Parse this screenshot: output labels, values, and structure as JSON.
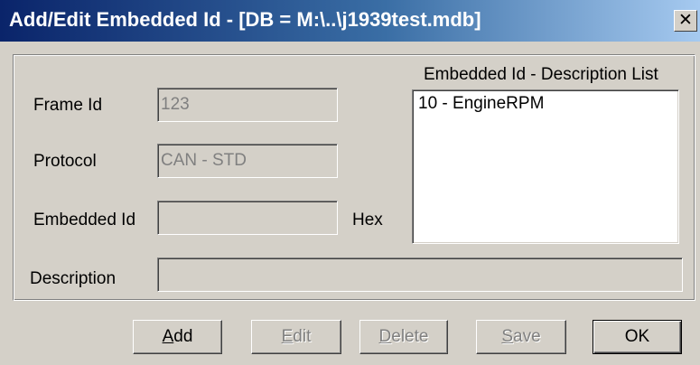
{
  "window": {
    "title": "Add/Edit Embedded Id - [DB = M:\\..\\j1939test.mdb]",
    "close_glyph": "✕"
  },
  "form": {
    "frame_id_label": "Frame Id",
    "frame_id_value": "123",
    "protocol_label": "Protocol",
    "protocol_value": "CAN - STD",
    "embedded_id_label": "Embedded Id",
    "embedded_id_value": "",
    "hex_label": "Hex",
    "description_label": "Description",
    "description_value": ""
  },
  "list": {
    "header": "Embedded Id - Description List",
    "items": [
      "10 - EngineRPM"
    ]
  },
  "buttons": {
    "add": {
      "mnemonic": "A",
      "rest": "dd",
      "enabled": true
    },
    "edit": {
      "mnemonic": "E",
      "rest": "dit",
      "enabled": false
    },
    "delete": {
      "mnemonic": "D",
      "rest": "elete",
      "enabled": false
    },
    "save": {
      "mnemonic": "S",
      "rest": "ave",
      "enabled": false
    },
    "ok": {
      "label": "OK",
      "enabled": true
    }
  }
}
